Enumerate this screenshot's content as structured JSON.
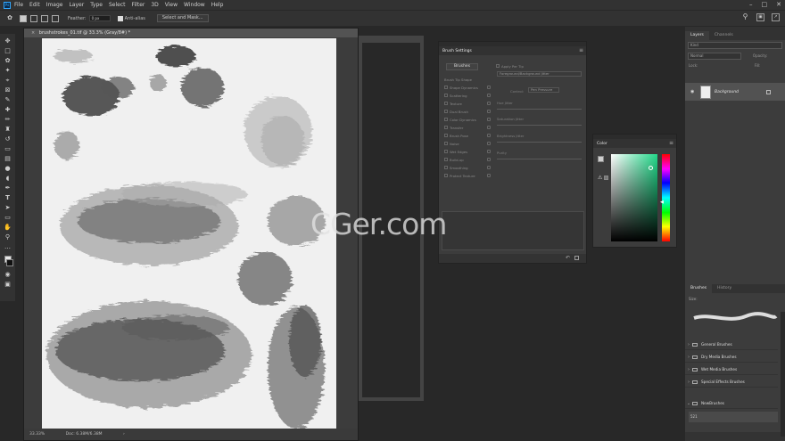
{
  "app": {
    "logo_text": "Ps"
  },
  "menu": [
    "File",
    "Edit",
    "Image",
    "Layer",
    "Type",
    "Select",
    "Filter",
    "3D",
    "View",
    "Window",
    "Help"
  ],
  "options_bar": {
    "feather_label": "Feather:",
    "feather_value": "0 px",
    "antialias_label": "Anti-alias",
    "select_mask_label": "Select and Mask..."
  },
  "document": {
    "tab_title": "brushstrokes_01.tif @ 33.3% (Gray/8#) *",
    "zoom": "33.33%",
    "doc_size": "Doc: 6.38M/6.38M"
  },
  "brush_settings": {
    "title": "Brush Settings",
    "brushes_button": "Brushes",
    "apply_per_tip": "Apply Per Tip",
    "dropdown_value": "Foreground/Background Jitter",
    "control_label": "Control:",
    "control_value": "Pen Pressure",
    "items": [
      "Brush Tip Shape",
      "Shape Dynamics",
      "Scattering",
      "Texture",
      "Dual Brush",
      "Color Dynamics",
      "Transfer",
      "Brush Pose",
      "Noise",
      "Wet Edges",
      "Build-up",
      "Smoothing",
      "Protect Texture"
    ],
    "right_labels": [
      "Hue Jitter",
      "Saturation Jitter",
      "Brightness Jitter",
      "Purity"
    ]
  },
  "color_panel": {
    "title": "Color",
    "fg_color": "#cfcfcf",
    "bg_color": "#111111",
    "field_hue": "#22d98a"
  },
  "layers_panel": {
    "tabs": [
      "Layers",
      "Channels"
    ],
    "kind_label": "Kind",
    "mode_label": "Normal",
    "opacity_label": "Opacity:",
    "lock_label": "Lock:",
    "fill_label": "Fill:",
    "layer_name": "Background"
  },
  "brushes_panel": {
    "tabs": [
      "Brushes",
      "History"
    ],
    "size_label": "Size:",
    "groups": [
      "General Brushes",
      "Dry Media Brushes",
      "Wet Media Brushes",
      "Special Effects Brushes",
      "NewBrushes"
    ],
    "size_readout": "521"
  },
  "watermark": "CGer.com"
}
